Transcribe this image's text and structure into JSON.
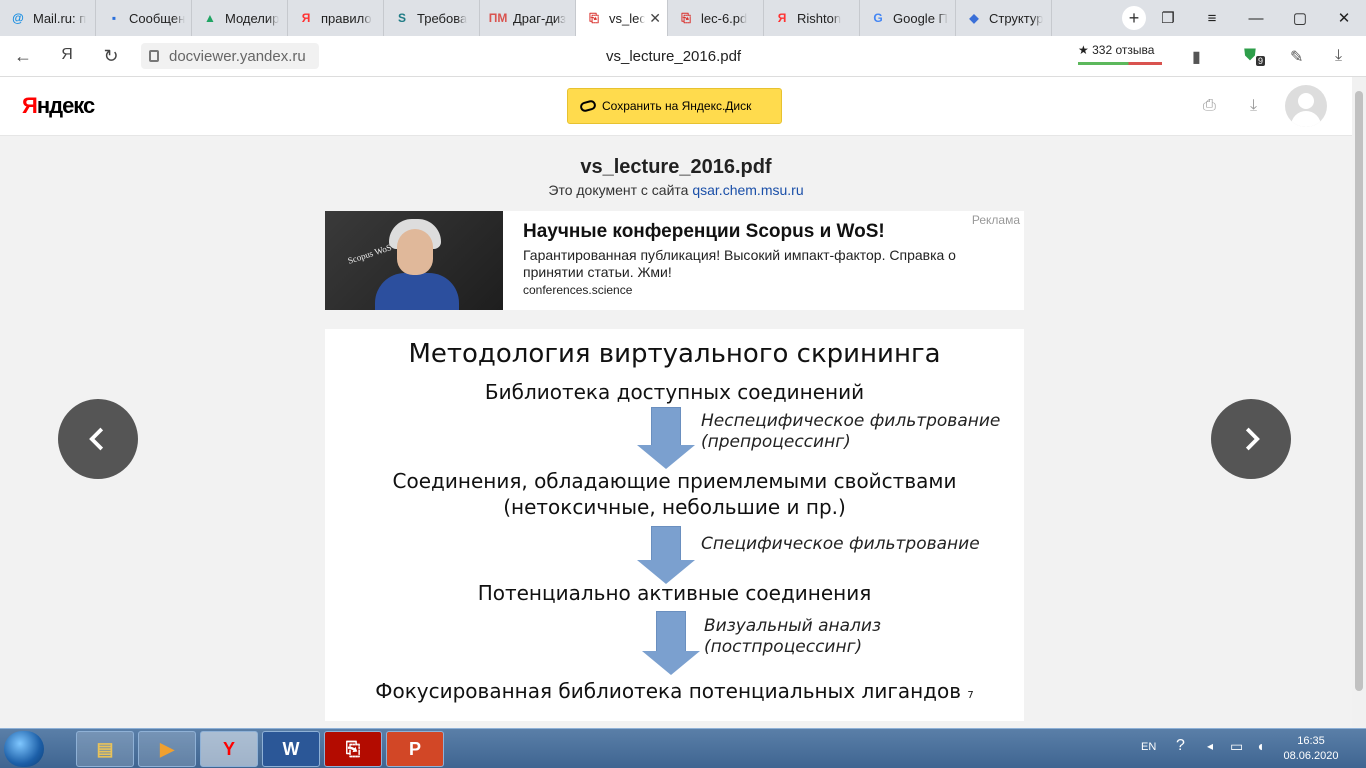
{
  "browser": {
    "tabs": [
      {
        "label": "Mail.ru: п",
        "icon": "mail-icon",
        "icon_glyph": "@",
        "color": "#168de2"
      },
      {
        "label": "Сообщени",
        "icon": "chat-icon",
        "icon_glyph": "▪",
        "color": "#2a6fdb"
      },
      {
        "label": "Моделир",
        "icon": "drive-icon",
        "icon_glyph": "▲",
        "color": "#1fa463"
      },
      {
        "label": "правило",
        "icon": "yandex-icon",
        "icon_glyph": "Я",
        "color": "#f33"
      },
      {
        "label": "Требова",
        "icon": "scribd-icon",
        "icon_glyph": "S",
        "color": "#1e7b85"
      },
      {
        "label": "Драг-диз",
        "icon": "pm-icon",
        "icon_glyph": "ПМ",
        "color": "#d9534f"
      },
      {
        "label": "vs_lec",
        "icon": "pdf-icon",
        "icon_glyph": "⎘",
        "color": "#d9302c",
        "active": true,
        "close": "✕"
      },
      {
        "label": "lec-6.pd",
        "icon": "pdf-icon",
        "icon_glyph": "⎘",
        "color": "#d9302c"
      },
      {
        "label": "Rishton",
        "icon": "yandex-icon",
        "icon_glyph": "Я",
        "color": "#f33"
      },
      {
        "label": "Google П",
        "icon": "translate-icon",
        "icon_glyph": "G",
        "color": "#4285f4"
      },
      {
        "label": "Структур",
        "icon": "diamond-icon",
        "icon_glyph": "◆",
        "color": "#3a6fd8"
      }
    ],
    "new_tab": "+",
    "url": "docviewer.yandex.ru",
    "page_title": "vs_lecture_2016.pdf",
    "rating": "★ 332 отзыва",
    "shield_count": "9"
  },
  "header": {
    "logo_first": "Я",
    "logo_rest": "ндекс",
    "save_button": "Сохранить на Яндекс.Диск"
  },
  "document": {
    "title": "vs_lecture_2016.pdf",
    "source_prefix": "Это документ с сайта ",
    "source_link": "qsar.chem.msu.ru"
  },
  "ad": {
    "label": "Реклама",
    "title": "Научные конференции Scopus и WoS!",
    "text": "Гарантированная публикация! Высокий импакт-фактор. Справка о принятии статьи. Жми!",
    "url": "conferences.science",
    "image_text": "Scopus WoS"
  },
  "slide": {
    "title": "Методология виртуального скрининга",
    "step1": "Библиотека доступных соединений",
    "note1_line1": "Неспецифическое фильтрование",
    "note1_line2": "(препроцессинг)",
    "step2_line1": "Соединения, обладающие приемлемыми свойствами",
    "step2_line2": "(нетоксичные, небольшие и пр.)",
    "note2": "Специфическое фильтрование",
    "step3": "Потенциально активные соединения",
    "note3_line1": "Визуальный анализ",
    "note3_line2": "(постпроцессинг)",
    "step4": "Фокусированная библиотека потенциальных лигандов",
    "page_number": "7",
    "arrow_color": "#7ba0cf"
  },
  "taskbar": {
    "lang": "EN",
    "time": "16:35",
    "date": "08.06.2020"
  }
}
